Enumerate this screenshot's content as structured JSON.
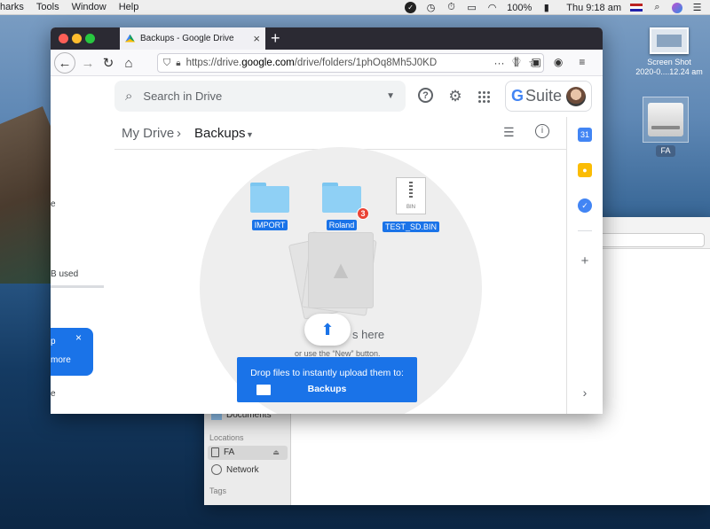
{
  "menubar": {
    "items": [
      "harks",
      "Tools",
      "Window",
      "Help"
    ],
    "battery": "100%",
    "clock": "Thu 9:18 am"
  },
  "desktop": {
    "screenshot_label_1": "Screen Shot",
    "screenshot_label_2": "2020-0....12.24 am",
    "drive_label": "FA"
  },
  "finder": {
    "sidebar_documents": "Documents",
    "locations_header": "Locations",
    "location_fa": "FA",
    "network": "Network",
    "tags_header": "Tags"
  },
  "browser": {
    "tab_title": "Backups - Google Drive",
    "url_prefix": "https://drive.",
    "url_domain": "google.com",
    "url_rest": "/drive/folders/1phOq8Mh5J0KD"
  },
  "drive": {
    "search_placeholder": "Search in Drive",
    "gsuite_label": "Suite",
    "breadcrumb": {
      "root": "My Drive",
      "separator": "›",
      "current": "Backups"
    },
    "leftnav": {
      "frag_e": "e",
      "storage_text": "B used",
      "promo_line1": "p",
      "promo_line2": "more",
      "frag_e2": "e"
    },
    "files": [
      {
        "name": "IMPORT",
        "type": "folder"
      },
      {
        "name": "Roland",
        "type": "folder",
        "badge": "3"
      },
      {
        "name": "TEST_SD.BIN",
        "type": "file",
        "ext": "BIN"
      }
    ],
    "drop_main": "s here",
    "drop_sub": "or use the “New” button.",
    "toast_line1": "Drop files to instantly upload them to:",
    "toast_line2": "Backups",
    "accent": "#1a73e8"
  }
}
